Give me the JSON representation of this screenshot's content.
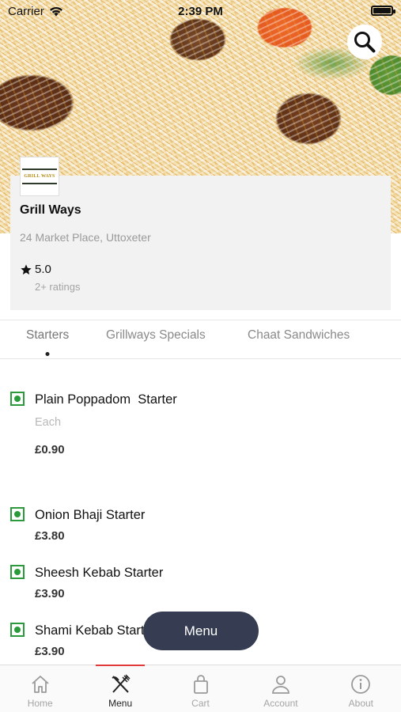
{
  "status_bar": {
    "carrier": "Carrier",
    "time": "2:39 PM"
  },
  "restaurant": {
    "logo_text": "GRILL WAYS",
    "name": "Grill Ways",
    "address": "24 Market Place, Uttoxeter",
    "rating": "5.0",
    "rating_count": "2+ ratings"
  },
  "tabs": [
    {
      "label": "Starters",
      "active": true
    },
    {
      "label": "Grillways Specials",
      "active": false
    },
    {
      "label": "Chaat Sandwiches",
      "active": false
    }
  ],
  "items": [
    {
      "name": "Plain Poppadom  Starter",
      "description": "Each",
      "price": "£0.90"
    },
    {
      "name": "Onion Bhaji Starter",
      "price": "£3.80"
    },
    {
      "name": "Sheesh Kebab Starter",
      "price": "£3.90"
    },
    {
      "name": "Shami Kebab Starter",
      "price": "£3.90"
    }
  ],
  "floating_button": {
    "label": "Menu"
  },
  "bottom_nav": [
    {
      "label": "Home",
      "icon": "home-icon"
    },
    {
      "label": "Menu",
      "icon": "fork-knife-icon",
      "active": true
    },
    {
      "label": "Cart",
      "icon": "bag-icon"
    },
    {
      "label": "Account",
      "icon": "user-icon"
    },
    {
      "label": "About",
      "icon": "info-icon"
    }
  ],
  "colors": {
    "accent": "#e23a3a",
    "veg": "#2a9a3a",
    "button": "#363d52"
  }
}
